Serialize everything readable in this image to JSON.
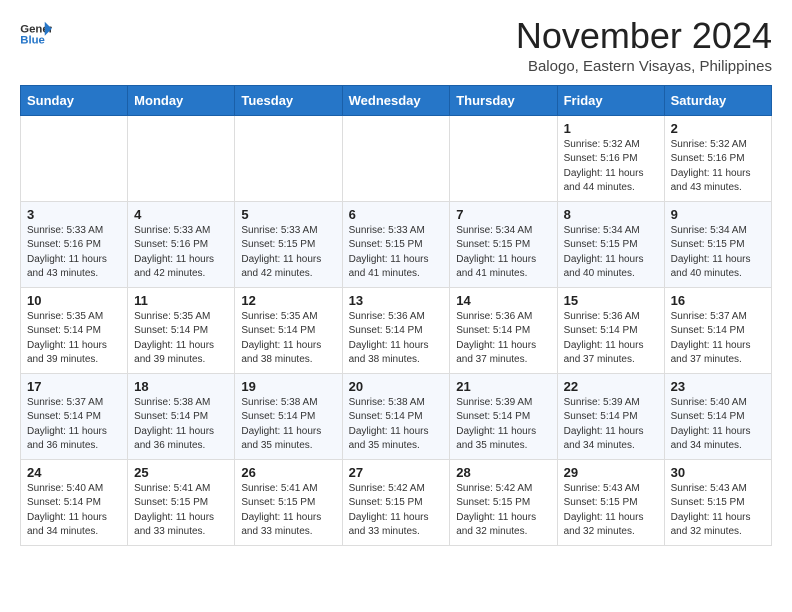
{
  "header": {
    "logo_line1": "General",
    "logo_line2": "Blue",
    "month": "November 2024",
    "location": "Balogo, Eastern Visayas, Philippines"
  },
  "weekdays": [
    "Sunday",
    "Monday",
    "Tuesday",
    "Wednesday",
    "Thursday",
    "Friday",
    "Saturday"
  ],
  "weeks": [
    [
      {
        "day": "",
        "info": ""
      },
      {
        "day": "",
        "info": ""
      },
      {
        "day": "",
        "info": ""
      },
      {
        "day": "",
        "info": ""
      },
      {
        "day": "",
        "info": ""
      },
      {
        "day": "1",
        "info": "Sunrise: 5:32 AM\nSunset: 5:16 PM\nDaylight: 11 hours\nand 44 minutes."
      },
      {
        "day": "2",
        "info": "Sunrise: 5:32 AM\nSunset: 5:16 PM\nDaylight: 11 hours\nand 43 minutes."
      }
    ],
    [
      {
        "day": "3",
        "info": "Sunrise: 5:33 AM\nSunset: 5:16 PM\nDaylight: 11 hours\nand 43 minutes."
      },
      {
        "day": "4",
        "info": "Sunrise: 5:33 AM\nSunset: 5:16 PM\nDaylight: 11 hours\nand 42 minutes."
      },
      {
        "day": "5",
        "info": "Sunrise: 5:33 AM\nSunset: 5:15 PM\nDaylight: 11 hours\nand 42 minutes."
      },
      {
        "day": "6",
        "info": "Sunrise: 5:33 AM\nSunset: 5:15 PM\nDaylight: 11 hours\nand 41 minutes."
      },
      {
        "day": "7",
        "info": "Sunrise: 5:34 AM\nSunset: 5:15 PM\nDaylight: 11 hours\nand 41 minutes."
      },
      {
        "day": "8",
        "info": "Sunrise: 5:34 AM\nSunset: 5:15 PM\nDaylight: 11 hours\nand 40 minutes."
      },
      {
        "day": "9",
        "info": "Sunrise: 5:34 AM\nSunset: 5:15 PM\nDaylight: 11 hours\nand 40 minutes."
      }
    ],
    [
      {
        "day": "10",
        "info": "Sunrise: 5:35 AM\nSunset: 5:14 PM\nDaylight: 11 hours\nand 39 minutes."
      },
      {
        "day": "11",
        "info": "Sunrise: 5:35 AM\nSunset: 5:14 PM\nDaylight: 11 hours\nand 39 minutes."
      },
      {
        "day": "12",
        "info": "Sunrise: 5:35 AM\nSunset: 5:14 PM\nDaylight: 11 hours\nand 38 minutes."
      },
      {
        "day": "13",
        "info": "Sunrise: 5:36 AM\nSunset: 5:14 PM\nDaylight: 11 hours\nand 38 minutes."
      },
      {
        "day": "14",
        "info": "Sunrise: 5:36 AM\nSunset: 5:14 PM\nDaylight: 11 hours\nand 37 minutes."
      },
      {
        "day": "15",
        "info": "Sunrise: 5:36 AM\nSunset: 5:14 PM\nDaylight: 11 hours\nand 37 minutes."
      },
      {
        "day": "16",
        "info": "Sunrise: 5:37 AM\nSunset: 5:14 PM\nDaylight: 11 hours\nand 37 minutes."
      }
    ],
    [
      {
        "day": "17",
        "info": "Sunrise: 5:37 AM\nSunset: 5:14 PM\nDaylight: 11 hours\nand 36 minutes."
      },
      {
        "day": "18",
        "info": "Sunrise: 5:38 AM\nSunset: 5:14 PM\nDaylight: 11 hours\nand 36 minutes."
      },
      {
        "day": "19",
        "info": "Sunrise: 5:38 AM\nSunset: 5:14 PM\nDaylight: 11 hours\nand 35 minutes."
      },
      {
        "day": "20",
        "info": "Sunrise: 5:38 AM\nSunset: 5:14 PM\nDaylight: 11 hours\nand 35 minutes."
      },
      {
        "day": "21",
        "info": "Sunrise: 5:39 AM\nSunset: 5:14 PM\nDaylight: 11 hours\nand 35 minutes."
      },
      {
        "day": "22",
        "info": "Sunrise: 5:39 AM\nSunset: 5:14 PM\nDaylight: 11 hours\nand 34 minutes."
      },
      {
        "day": "23",
        "info": "Sunrise: 5:40 AM\nSunset: 5:14 PM\nDaylight: 11 hours\nand 34 minutes."
      }
    ],
    [
      {
        "day": "24",
        "info": "Sunrise: 5:40 AM\nSunset: 5:14 PM\nDaylight: 11 hours\nand 34 minutes."
      },
      {
        "day": "25",
        "info": "Sunrise: 5:41 AM\nSunset: 5:15 PM\nDaylight: 11 hours\nand 33 minutes."
      },
      {
        "day": "26",
        "info": "Sunrise: 5:41 AM\nSunset: 5:15 PM\nDaylight: 11 hours\nand 33 minutes."
      },
      {
        "day": "27",
        "info": "Sunrise: 5:42 AM\nSunset: 5:15 PM\nDaylight: 11 hours\nand 33 minutes."
      },
      {
        "day": "28",
        "info": "Sunrise: 5:42 AM\nSunset: 5:15 PM\nDaylight: 11 hours\nand 32 minutes."
      },
      {
        "day": "29",
        "info": "Sunrise: 5:43 AM\nSunset: 5:15 PM\nDaylight: 11 hours\nand 32 minutes."
      },
      {
        "day": "30",
        "info": "Sunrise: 5:43 AM\nSunset: 5:15 PM\nDaylight: 11 hours\nand 32 minutes."
      }
    ]
  ]
}
